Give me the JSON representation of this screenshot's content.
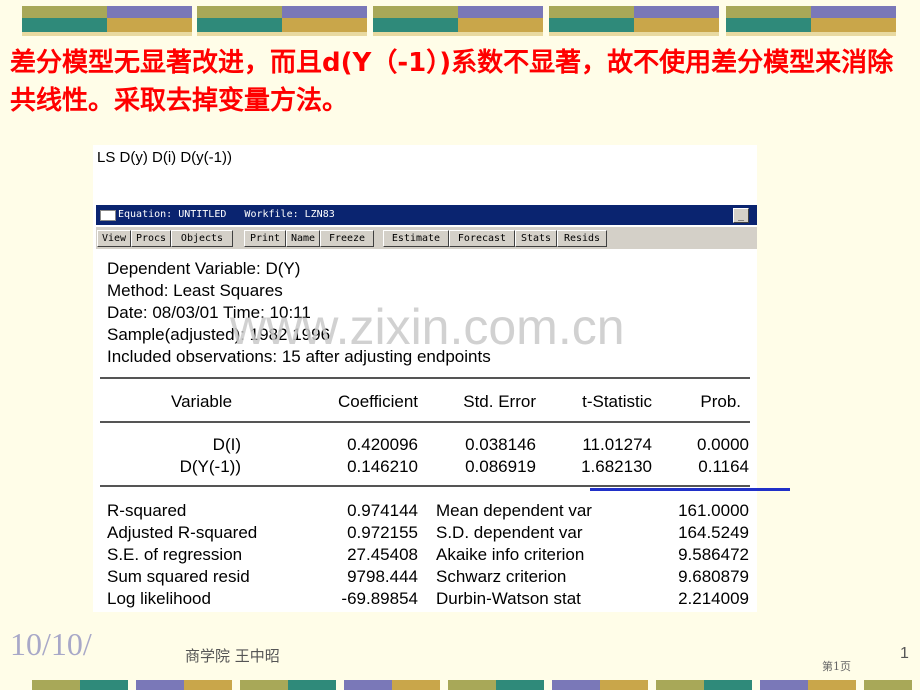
{
  "slide": {
    "title": "差分模型无显著改进，而且d(Y（-1）)系数不显著，故不使用差分模型来消除共线性。采取去掉变量方法。",
    "footer_date": "10/10/",
    "footer_author": "商学院 王中昭",
    "footer_page_label": "第1页",
    "slide_number": "1",
    "watermark": "www.zixin.com.cn"
  },
  "colors": {
    "title": "#ff0000",
    "deco_teal": "#2f8a7a",
    "deco_gold": "#c9a64a",
    "deco_purple": "#7a78b8",
    "deco_olive": "#a8a858",
    "window_title_bg": "#0a2470",
    "highlight_line": "#2030c8"
  },
  "command_line": "LS D(y) D(i) D(y(-1))",
  "window": {
    "title": "Equation: UNTITLED   Workfile: LZN83",
    "toolbar": [
      "View",
      "Procs",
      "Objects",
      "Print",
      "Name",
      "Freeze",
      "Estimate",
      "Forecast",
      "Stats",
      "Resids"
    ]
  },
  "output": {
    "header_lines": [
      "Dependent Variable: D(Y)",
      "Method: Least Squares",
      "Date: 08/03/01   Time: 10:11",
      "Sample(adjusted): 1982 1996",
      "Included observations: 15 after adjusting endpoints"
    ],
    "columns": [
      "Variable",
      "Coefficient",
      "Std. Error",
      "t-Statistic",
      "Prob."
    ],
    "rows": [
      [
        "D(I)",
        "0.420096",
        "0.038146",
        "11.01274",
        "0.0000"
      ],
      [
        "D(Y(-1))",
        "0.146210",
        "0.086919",
        "1.682130",
        "0.1164"
      ]
    ],
    "stats": [
      [
        "R-squared",
        "0.974144",
        "Mean dependent var",
        "161.0000"
      ],
      [
        "Adjusted R-squared",
        "0.972155",
        "S.D. dependent var",
        "164.5249"
      ],
      [
        "S.E. of regression",
        "27.45408",
        "Akaike info criterion",
        "9.586472"
      ],
      [
        "Sum squared resid",
        "9798.444",
        "Schwarz criterion",
        "9.680879"
      ],
      [
        "Log likelihood",
        "-69.89854",
        "Durbin-Watson stat",
        "2.214009"
      ]
    ]
  }
}
